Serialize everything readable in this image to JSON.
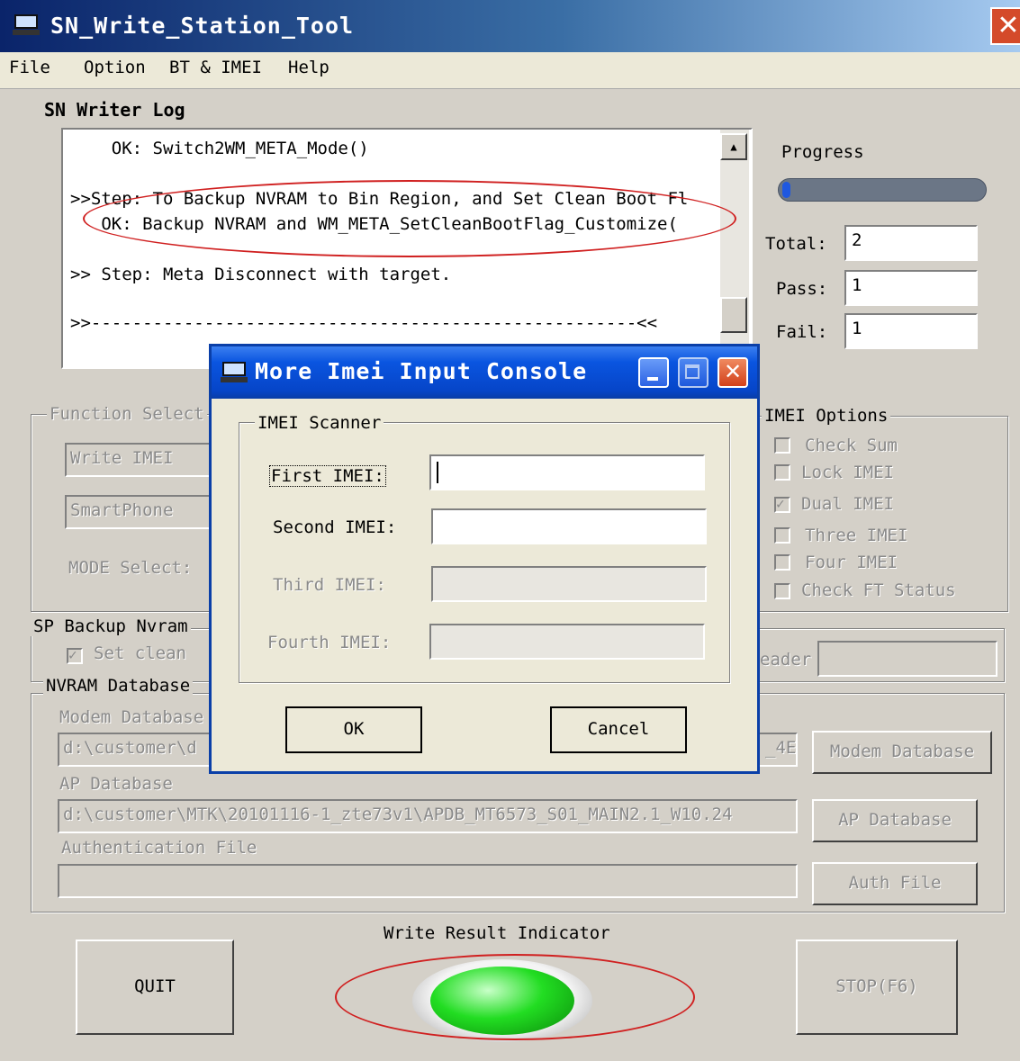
{
  "window": {
    "title": "SN_Write_Station_Tool",
    "close_glyph": "✕"
  },
  "menu": [
    "File",
    "Option",
    "BT & IMEI",
    "Help"
  ],
  "log": {
    "label": "SN Writer Log",
    "lines": [
      "    OK: Switch2WM_META_Mode()",
      ">>Step: To Backup NVRAM to Bin Region, and Set Clean Boot Fl",
      "   OK: Backup NVRAM and WM_META_SetCleanBootFlag_Customize(",
      ">> Step: Meta Disconnect with target.",
      ">>-----------------------------------------------------<<"
    ],
    "scroll_up_glyph": "▲"
  },
  "progress": {
    "label": "Progress",
    "total_label": "Total:",
    "total_value": "2",
    "pass_label": "Pass:",
    "pass_value": "1",
    "fail_label": "Fail:",
    "fail_value": "1"
  },
  "function_select": {
    "label": "Function Select",
    "combo1": "Write IMEI",
    "combo2": "SmartPhone",
    "mode_label": "MODE Select:"
  },
  "imei_options": {
    "label": "IMEI Options",
    "items": [
      {
        "label": "Check Sum",
        "checked": false
      },
      {
        "label": "Lock IMEI",
        "checked": false
      },
      {
        "label": "Dual IMEI",
        "checked": true
      },
      {
        "label": "Three IMEI",
        "checked": false
      },
      {
        "label": "Four IMEI",
        "checked": false
      },
      {
        "label": "Check FT Status",
        "checked": false
      }
    ]
  },
  "sp_backup": {
    "label": "SP Backup Nvram",
    "set_clean_label": "Set clean",
    "header_label": "eader"
  },
  "nvram_db": {
    "label": "NVRAM Database",
    "modem_label": "Modem Database",
    "modem_path": "d:\\customer\\d",
    "modem_path_tail": "_4E",
    "modem_button": "Modem Database",
    "ap_label": "AP Database",
    "ap_path": "d:\\customer\\MTK\\20101116-1_zte73v1\\APDB_MT6573_S01_MAIN2.1_W10.24",
    "ap_button": "AP Database",
    "auth_label": "Authentication File",
    "auth_path": "",
    "auth_button": "Auth File"
  },
  "bottom": {
    "quit": "QUIT",
    "indicator_label": "Write Result Indicator",
    "stop": "STOP(F6)",
    "indicator_color": "#22dd22"
  },
  "dialog": {
    "title": "More Imei Input Console",
    "group_label": "IMEI Scanner",
    "first_label": "First IMEI:",
    "first_value": "",
    "second_label": "Second IMEI:",
    "second_value": "",
    "third_label": "Third IMEI:",
    "third_value": "",
    "fourth_label": "Fourth IMEI:",
    "fourth_value": "",
    "ok": "OK",
    "cancel": "Cancel",
    "close_glyph": "✕"
  },
  "colors": {
    "annotation_red": "#d02020",
    "title_blue": "#0a246a"
  }
}
